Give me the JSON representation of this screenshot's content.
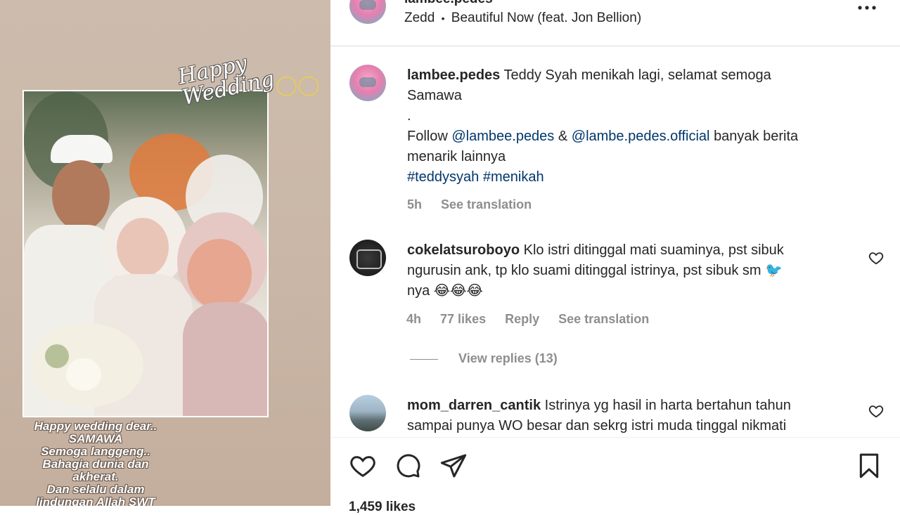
{
  "media": {
    "stamp_text": "Happy Wedding",
    "caption_lines": [
      "Happy wedding dear..",
      "SAMAWA",
      "Semoga langgeng..",
      "Bahagia dunia dan",
      "akherat.",
      "Dan selalu dalam",
      "lindungan Allah SWT"
    ]
  },
  "header": {
    "username": "lambee.pedes",
    "artist": "Zedd",
    "separator": "•",
    "song": "Beautiful Now (feat. Jon Bellion)"
  },
  "post": {
    "username": "lambee.pedes",
    "text_line1": "Teddy Syah menikah lagi, selamat semoga",
    "text_line2": "Samawa",
    "text_dot": ".",
    "follow_prefix": "Follow",
    "mention1": "@lambee.pedes",
    "amp": "&",
    "mention2": "@lambe.pedes.official",
    "follow_suffix": "banyak berita",
    "follow_line2": "menarik lainnya",
    "hashtag1": "#teddysyah",
    "hashtag2": "#menikah",
    "time": "5h",
    "see_translation": "See translation"
  },
  "comments": [
    {
      "username": "cokelatsuroboyo",
      "line1": "Klo istri ditinggal mati suaminya, pst sibuk",
      "line2": "ngurusin ank, tp klo suami ditinggal istrinya, pst sibuk sm 🐦",
      "line3": "nya 😂😂😂",
      "time": "4h",
      "likes": "77 likes",
      "reply": "Reply",
      "see_translation": "See translation",
      "view_replies": "View replies (13)"
    },
    {
      "username": "mom_darren_cantik",
      "line1": "Istrinya yg hasil in harta bertahun tahun",
      "line2": "sampai punya WO besar dan sekrg istri muda tinggal nikmati"
    }
  ],
  "footer": {
    "likes": "1,459 likes"
  },
  "colors": {
    "text": "#262626",
    "secondary": "#8e8e8e",
    "link": "#00376b",
    "border": "#dbdbdb"
  }
}
